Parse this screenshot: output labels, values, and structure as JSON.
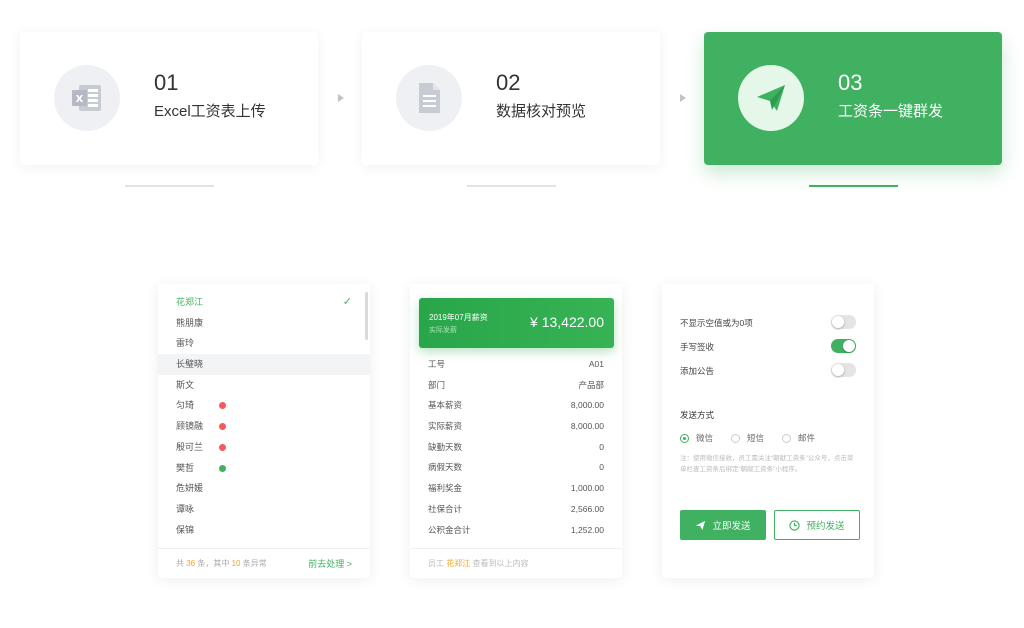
{
  "steps": [
    {
      "num": "01",
      "label": "Excel工资表上传",
      "icon": "excel-icon"
    },
    {
      "num": "02",
      "label": "数据核对预览",
      "icon": "document-icon"
    },
    {
      "num": "03",
      "label": "工资条一键群发",
      "icon": "paper-plane-icon"
    }
  ],
  "colors": {
    "accent": "#3fb160",
    "warning": "#f5595c",
    "highlight": "#f5a623"
  },
  "employees": [
    {
      "name": "花郑江",
      "active": true
    },
    {
      "name": "熊朋康"
    },
    {
      "name": "雷玲"
    },
    {
      "name": "长璧晓",
      "hover": true
    },
    {
      "name": "斯文"
    },
    {
      "name": "匀琦",
      "status": "red"
    },
    {
      "name": "顾镜融",
      "status": "red"
    },
    {
      "name": "殷可兰",
      "status": "red"
    },
    {
      "name": "樊哲",
      "status": "green"
    },
    {
      "name": "危妍媛"
    },
    {
      "name": "谭咏"
    },
    {
      "name": "保锦"
    }
  ],
  "employee_footer": {
    "pre": "共 ",
    "total": "36",
    "mid": " 条，其中 ",
    "issues": "10",
    "post": " 条异常",
    "action": "前去处理 >"
  },
  "payslip": {
    "month_title": "2019年07月薪资",
    "sub": "实际发薪",
    "amount": "¥ 13,422.00",
    "rows": [
      {
        "k": "工号",
        "v": "A01"
      },
      {
        "k": "部门",
        "v": "产品部"
      },
      {
        "k": "基本薪资",
        "v": "8,000.00"
      },
      {
        "k": "实际薪资",
        "v": "8,000.00"
      },
      {
        "k": "缺勤天数",
        "v": "0"
      },
      {
        "k": "病假天数",
        "v": "0"
      },
      {
        "k": "福利奖金",
        "v": "1,000.00"
      },
      {
        "k": "社保合计",
        "v": "2,566.00"
      },
      {
        "k": "公积金合计",
        "v": "1,252.00"
      }
    ],
    "footer_pre": "员工 ",
    "footer_name": "花郑江",
    "footer_post": " 查看到以上内容"
  },
  "options": {
    "toggles": [
      {
        "label": "不显示空值或为0项",
        "on": false
      },
      {
        "label": "手写签收",
        "on": true
      },
      {
        "label": "添加公告",
        "on": false
      }
    ],
    "send_title": "发送方式",
    "methods": [
      {
        "label": "微信",
        "selected": true
      },
      {
        "label": "短信",
        "selected": false
      },
      {
        "label": "邮件",
        "selected": false
      }
    ],
    "note": "注：使用微信接收，员工需关注“朝献工资条”公众号，点击菜单栏查工资条后绑定“朝献工资条”小程序。",
    "send_now": "立即发送",
    "schedule": "预约发送"
  }
}
